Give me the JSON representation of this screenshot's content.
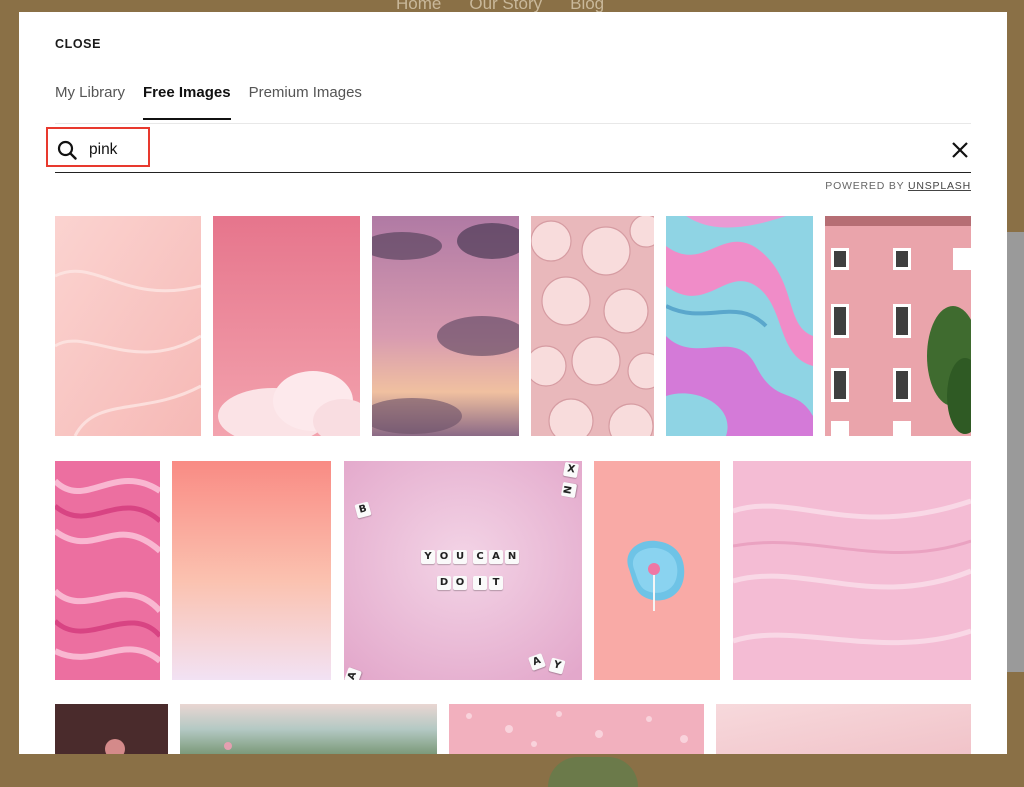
{
  "background_nav": [
    "Home",
    "Our Story",
    "Blog"
  ],
  "modal": {
    "close_label": "CLOSE",
    "tabs": [
      {
        "label": "My Library",
        "active": false
      },
      {
        "label": "Free Images",
        "active": true
      },
      {
        "label": "Premium Images",
        "active": false
      }
    ],
    "search": {
      "value": "pink",
      "icon": "search-icon",
      "clear_icon": "close-icon"
    },
    "powered_by": {
      "prefix": "POWERED BY",
      "link": "UNSPLASH"
    },
    "images": [
      {
        "row": 1,
        "subject": "pink marble texture"
      },
      {
        "row": 1,
        "subject": "pink sky with white cloud"
      },
      {
        "row": 1,
        "subject": "pink purple sunset clouds"
      },
      {
        "row": 1,
        "subject": "pink carnation flowers"
      },
      {
        "row": 1,
        "subject": "pink blue fluid art"
      },
      {
        "row": 1,
        "subject": "pink building facade"
      },
      {
        "row": 2,
        "subject": "hot pink marble swirl"
      },
      {
        "row": 2,
        "subject": "pink gradient"
      },
      {
        "row": 2,
        "subject": "letter tiles on pink background"
      },
      {
        "row": 2,
        "subject": "lollipop on blue plate"
      },
      {
        "row": 2,
        "subject": "pink watercolor texture"
      },
      {
        "row": 3,
        "subject": "dark pink flower"
      },
      {
        "row": 3,
        "subject": "pink sky over meadow"
      },
      {
        "row": 3,
        "subject": "pink water droplets"
      },
      {
        "row": 3,
        "subject": "soft pink gradient"
      }
    ],
    "tiles": {
      "line1": [
        "Y",
        "O",
        "U",
        "C",
        "A",
        "N"
      ],
      "line2": [
        "D",
        "O",
        "I",
        "T"
      ],
      "scattered": [
        "B",
        "X",
        "N",
        "A",
        "Y",
        "A"
      ]
    }
  },
  "colors": {
    "accent": "#e8392e",
    "text": "#111111",
    "backdrop": "#8a7046"
  }
}
